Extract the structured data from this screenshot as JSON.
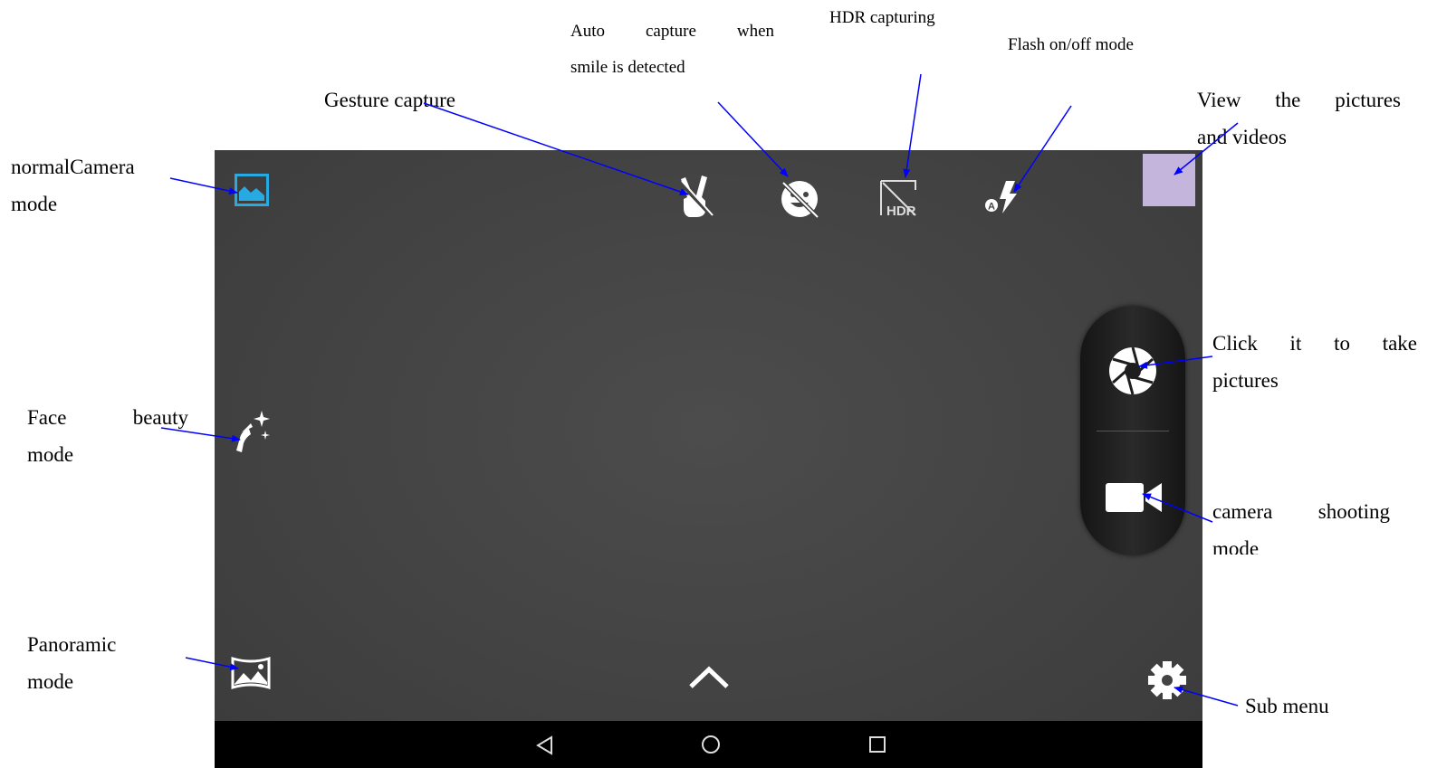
{
  "labels": {
    "normal_camera_1": "normalCamera",
    "normal_camera_2": "mode",
    "face_beauty_1a": "Face",
    "face_beauty_1b": "beauty",
    "face_beauty_2": "mode",
    "panoramic_1": "Panoramic",
    "panoramic_2": "mode",
    "gesture": "Gesture capture",
    "auto_capture_1": "Auto capture when",
    "auto_capture_2": "smile is detected",
    "hdr": "HDR capturing",
    "flash": "Flash on/off mode",
    "view_1": "View the pictures",
    "view_2": "and videos",
    "shutter_1": "Click it to take",
    "shutter_2": "pictures",
    "video_1": "camera shooting",
    "video_2": "mode",
    "submenu": "Sub menu"
  },
  "screen": {
    "hdr_icon_text": "HDR",
    "flash_auto_glyph": "A"
  },
  "colors": {
    "arrow": "#0000ff",
    "screen_bg": "#434343",
    "navbar": "#000000",
    "mode_icon_accent": "#27a9e1",
    "thumbnail": "#c4b5dd"
  },
  "icons": [
    "image-icon",
    "gesture-icon",
    "smile-icon",
    "hdr-icon",
    "flash-icon",
    "beauty-icon",
    "panorama-icon",
    "chevron-up-icon",
    "shutter-icon",
    "video-icon",
    "gear-icon",
    "back-icon",
    "home-icon",
    "recents-icon"
  ]
}
